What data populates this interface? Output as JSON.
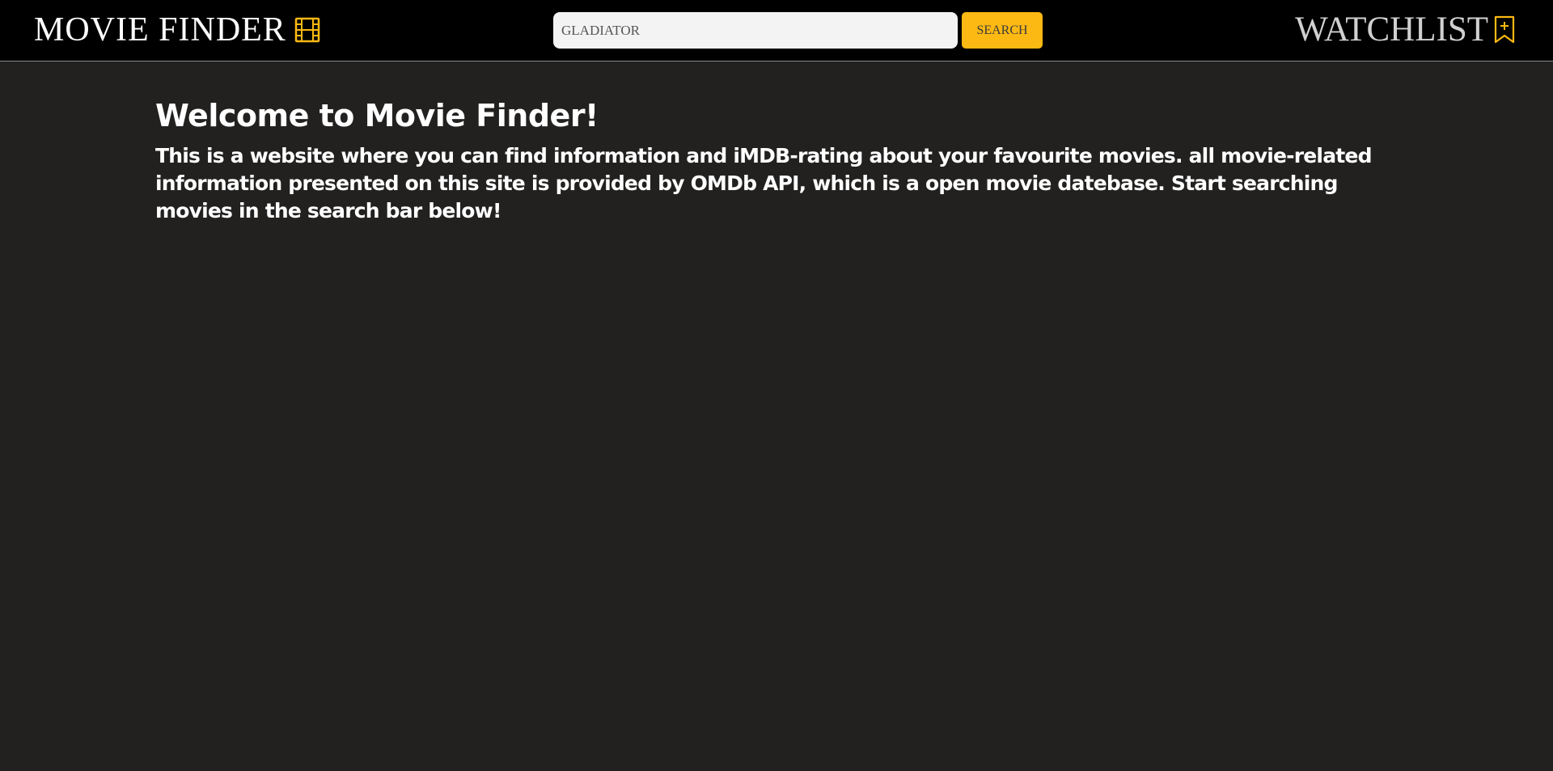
{
  "header": {
    "brand": "MOVIE FINDER",
    "brand_icon": "film-icon",
    "search": {
      "value": "GLADIATOR",
      "placeholder": "GLADIATOR",
      "button_label": "SEARCH"
    },
    "watchlist_label": "WATCHLIST",
    "watchlist_icon": "bookmark-plus-icon"
  },
  "main": {
    "title": "Welcome to Movie Finder!",
    "description": "This is a website where you can find information and iMDB-rating about your favourite movies. all movie-related information presented on this site is provided by OMDb API, which is a open movie datebase. Start searching movies in the search bar below!"
  },
  "colors": {
    "background": "#222120",
    "navbar": "#000000",
    "accent": "#fdb913",
    "text": "#ffffff"
  }
}
